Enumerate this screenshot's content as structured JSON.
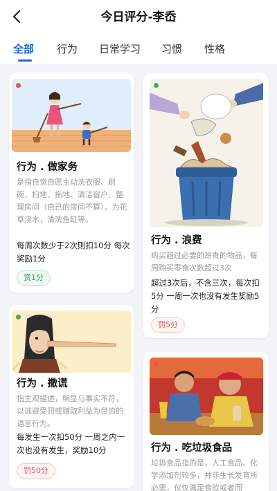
{
  "header": {
    "title": "今日评分-李岙",
    "back_icon": "chevron-left-icon"
  },
  "tabs": [
    {
      "label": "全部",
      "active": true
    },
    {
      "label": "行为",
      "active": false
    },
    {
      "label": "日常学习",
      "active": false
    },
    {
      "label": "习惯",
      "active": false
    },
    {
      "label": "性格",
      "active": false
    }
  ],
  "colors": {
    "accent": "#1b66d6",
    "reward": "#3a9a55",
    "penalty": "#e05555",
    "dot_red": "#e55353",
    "dot_green": "#3fae5a"
  },
  "cards": [
    {
      "title": "行为 . 做家务",
      "description": "是指自觉自愿主动洗衣服、刷碗、扫地、拖地、清洁窗户、整理房间（自己的房间不算），为花草浇水，清洗鱼缸等。",
      "rule": "每周次数少于2次则扣10分 每次奖励1分",
      "badge": "赏1分",
      "badge_type": "reward",
      "dot": "red",
      "image": "mother-and-child-sweeping-illustration"
    },
    {
      "title": "行为 . 浪费",
      "description": "购买超过必要的昂贵的物品，每周购买零食次数超过3次",
      "rule": "超过3次后，不含三次，每次扣5分 一周一次也没有发生奖励5分",
      "badge": "罚5分",
      "badge_type": "penalty",
      "dot": "green",
      "image": "food-thrown-in-trash-can-illustration"
    },
    {
      "title": "行为 . 撒谎",
      "description": "指主观描述，明显与事实不符，以逃避受罚或赚取利益为目的的语言行为。",
      "rule": "每发生一次扣50分 一周之内一次也没有发生，奖励10分",
      "badge": "罚50分",
      "badge_type": "penalty",
      "dot": "green",
      "image": "long-nose-liar-illustration"
    },
    {
      "title": "行为 . 吃垃圾食品",
      "description": "垃圾食品指的是，人工食品、化学添加剂较多，并非生长发育所必需，仅仅满足食欲或者而",
      "rule": "",
      "badge": "",
      "badge_type": "penalty",
      "dot": "red",
      "image": "kids-eating-fast-food-photo"
    }
  ]
}
